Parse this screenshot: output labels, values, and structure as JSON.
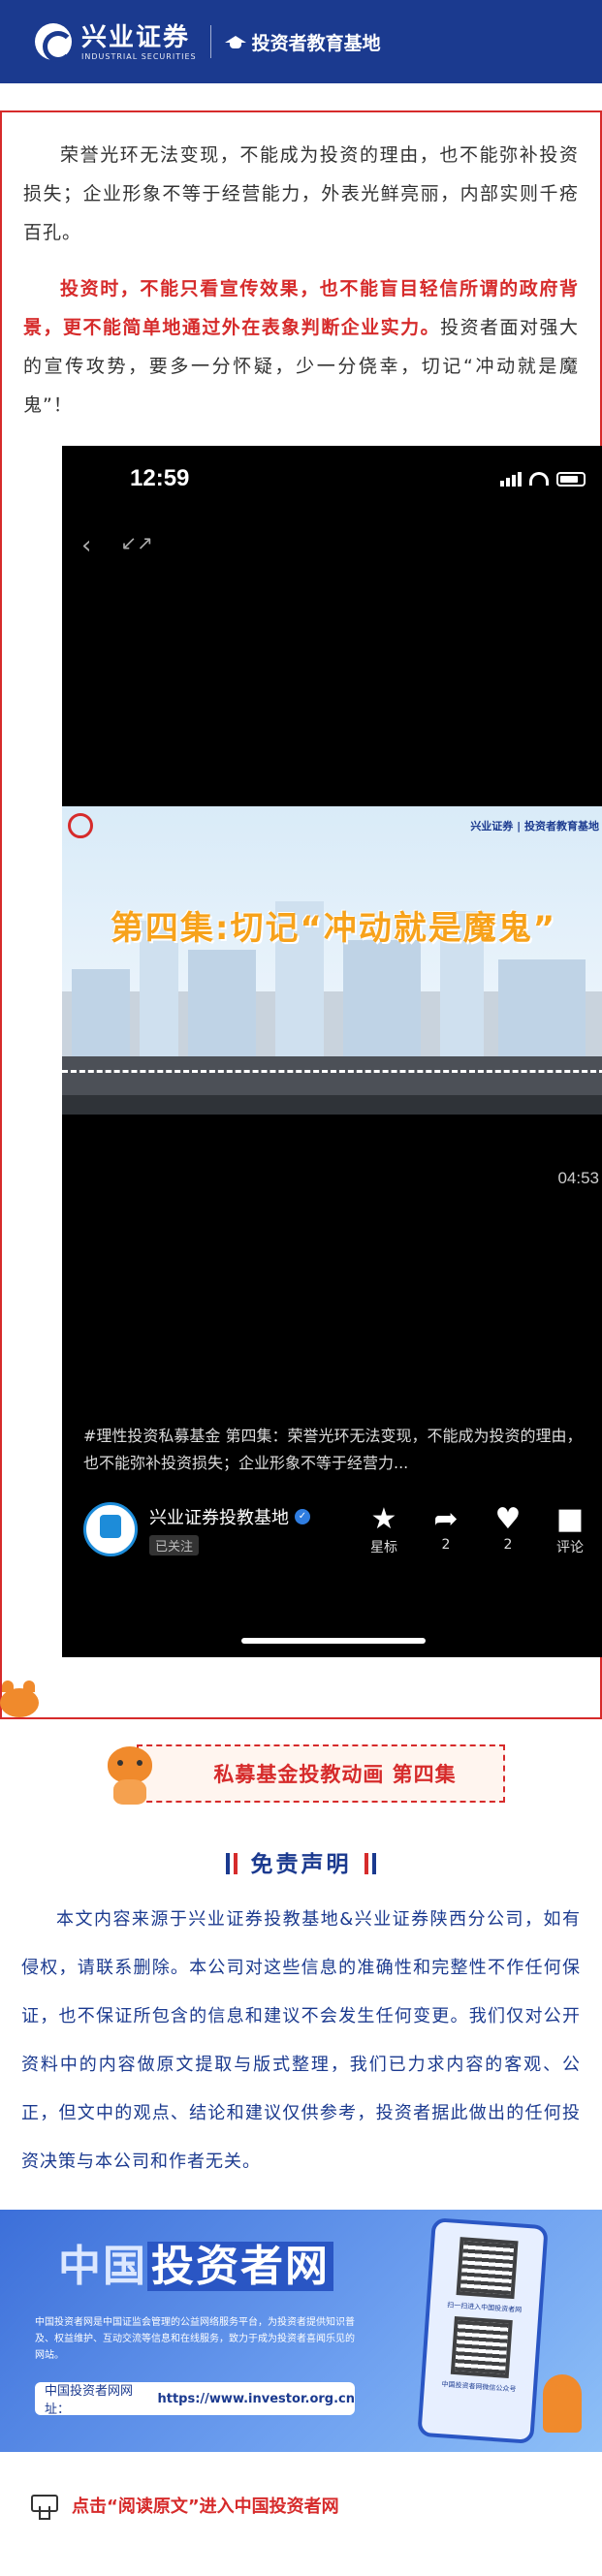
{
  "header": {
    "brand_cn": "兴业证券",
    "brand_en": "INDUSTRIAL SECURITIES",
    "edu_label": "投资者教育基地"
  },
  "article": {
    "para1": "荣誉光环无法变现，不能成为投资的理由，也不能弥补投资损失；企业形象不等于经营能力，外表光鲜亮丽，内部实则千疮百孔。",
    "para2_red": "投资时，不能只看宣传效果，也不能盲目轻信所谓的政府背景，更不能简单地通过外在表象判断企业实力。",
    "para2_rest": "投资者面对强大的宣传攻势，要多一分怀疑，少一分侥幸，切记“冲动就是魔鬼”！"
  },
  "video": {
    "status_time": "12:59",
    "frame_brands": "兴业证券 | 投资者教育基地",
    "frame_title": "第四集:切记“冲动就是魔鬼”",
    "duration": "04:53",
    "caption": "#理性投资私募基金 第四集：荣誉光环无法变现，不能成为投资的理由，也不能弥补投资损失；企业形象不等于经营力...",
    "author": "兴业证券投教基地",
    "follow_status": "已关注",
    "actions": [
      {
        "icon": "star-icon",
        "label": "星标"
      },
      {
        "icon": "share-icon",
        "label": "2"
      },
      {
        "icon": "heart-icon",
        "label": "2"
      },
      {
        "icon": "comment-icon",
        "label": "评论"
      }
    ]
  },
  "banner": {
    "title": "私募基金投教动画  第四集"
  },
  "disclaimer": {
    "title": "免责声明",
    "text": "本文内容来源于兴业证券投教基地&兴业证券陕西分公司，如有侵权，请联系删除。本公司对这些信息的准确性和完整性不作任何保证，也不保证所包含的信息和建议不会发生任何变更。我们仅对公开资料中的内容做原文提取与版式整理，我们已力求内容的客观、公正，但文中的观点、结论和建议仅供参考，投资者据此做出的任何投资决策与本公司和作者无关。"
  },
  "site": {
    "title_a": "中国",
    "title_b": "投资者网",
    "desc": "中国投资者网是中国证监会管理的公益网络服务平台，为投资者提供知识普及、权益维护、互动交流等信息和在线服务，致力于成为投资者喜闻乐见的网站。",
    "url_label": "中国投资者网网址：",
    "url": "https://www.investor.org.cn",
    "qr_caption": "扫一扫进入中国投资者网",
    "qr_caption2": "中国投资者网微信公众号"
  },
  "footer": {
    "read_more": "点击“阅读原文”进入中国投资者网"
  },
  "colors": {
    "brand_blue": "#1b3a8f",
    "accent_red": "#d62b2b"
  }
}
